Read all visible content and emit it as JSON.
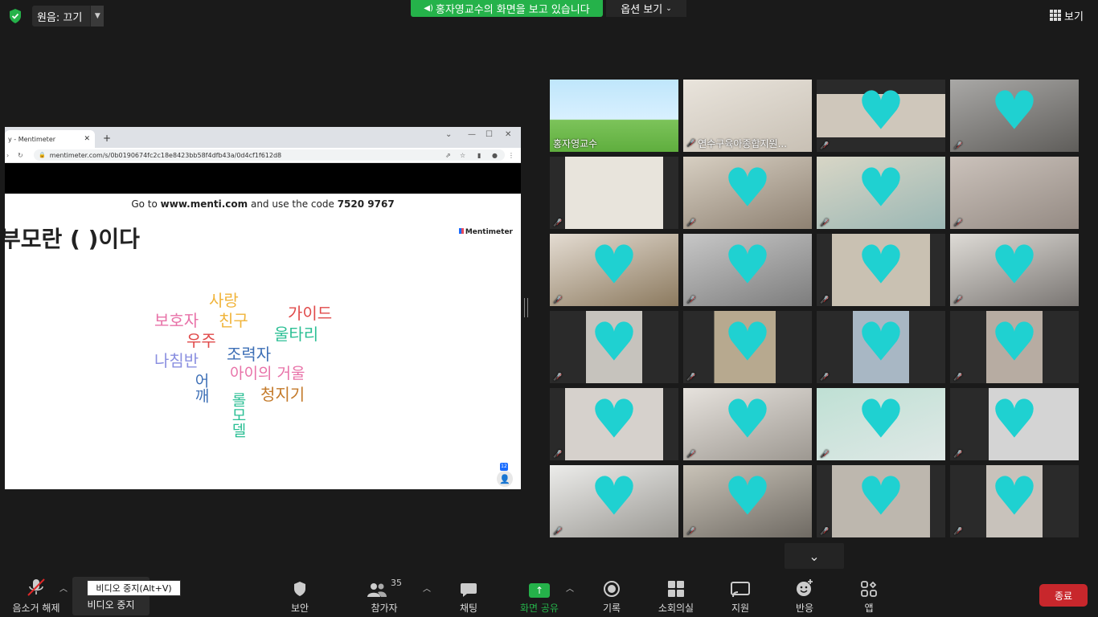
{
  "topbar": {
    "original_sound": "원음: 끄기",
    "share_banner": "홍자영교수의 화면을 보고 있습니다",
    "view_options": "옵션 보기",
    "view_label": "보기"
  },
  "shared_screen": {
    "browser_tab": "y - Mentimeter",
    "url": "mentimeter.com/s/0b0190674fc2c18e8423bb58f4dfb43a/0d4cf1f612d8",
    "code_prefix": "Go to ",
    "code_site": "www.menti.com",
    "code_mid": " and use the code ",
    "code_value": "7520 9767",
    "title": "부모란 ( )이다",
    "logo": "Mentimeter",
    "participant_count": "12",
    "words": [
      {
        "text": "사랑",
        "color": "#f0b43a"
      },
      {
        "text": "가이드",
        "color": "#e04a4a"
      },
      {
        "text": "보호자",
        "color": "#e872a8"
      },
      {
        "text": "친구",
        "color": "#f0b43a"
      },
      {
        "text": "울타리",
        "color": "#2bbf94"
      },
      {
        "text": "우주",
        "color": "#e04a4a"
      },
      {
        "text": "조력자",
        "color": "#3d6fb6"
      },
      {
        "text": "나침반",
        "color": "#8a8fe0"
      },
      {
        "text": "아이의 거울",
        "color": "#e872a8"
      },
      {
        "text": "청지기",
        "color": "#c47a2a"
      },
      {
        "text": "어깨",
        "color": "#3d6fb6"
      },
      {
        "text": "롤모델",
        "color": "#2bbf94"
      }
    ]
  },
  "gallery": {
    "participants": [
      {
        "name": "홍자영교수",
        "muted": false,
        "heart": false
      },
      {
        "name": "연수구육아종합지원...",
        "muted": true,
        "heart": false
      },
      {
        "name": "",
        "muted": true,
        "heart": true
      },
      {
        "name": "",
        "muted": true,
        "heart": true
      },
      {
        "name": "",
        "muted": true,
        "heart": false
      },
      {
        "name": "",
        "muted": true,
        "heart": true
      },
      {
        "name": "",
        "muted": true,
        "heart": true
      },
      {
        "name": "",
        "muted": true,
        "heart": false
      },
      {
        "name": "",
        "muted": true,
        "heart": true
      },
      {
        "name": "",
        "muted": true,
        "heart": true
      },
      {
        "name": "",
        "muted": true,
        "heart": true
      },
      {
        "name": "",
        "muted": true,
        "heart": true
      },
      {
        "name": "",
        "muted": true,
        "heart": true
      },
      {
        "name": "",
        "muted": true,
        "heart": true
      },
      {
        "name": "",
        "muted": true,
        "heart": true
      },
      {
        "name": "",
        "muted": true,
        "heart": true
      },
      {
        "name": "",
        "muted": true,
        "heart": true
      },
      {
        "name": "",
        "muted": true,
        "heart": true
      },
      {
        "name": "",
        "muted": true,
        "heart": true
      },
      {
        "name": "",
        "muted": true,
        "heart": true
      },
      {
        "name": "",
        "muted": true,
        "heart": true
      },
      {
        "name": "",
        "muted": true,
        "heart": true
      },
      {
        "name": "",
        "muted": true,
        "heart": true
      },
      {
        "name": "",
        "muted": true,
        "heart": true
      }
    ]
  },
  "toolbar": {
    "unmute": "음소거 해제",
    "stop_video": "비디오 중지",
    "tooltip": "비디오 중지(Alt+V)",
    "security": "보안",
    "participants": "참가자",
    "participant_count": "35",
    "chat": "채팅",
    "share_screen": "화면 공유",
    "record": "기록",
    "breakout": "소회의실",
    "support": "지원",
    "reactions": "반응",
    "apps": "앱",
    "end": "종료"
  },
  "colors": {
    "share_green": "#25b24a",
    "end_red": "#c8272c",
    "heart": "#1fd1d1",
    "active_speaker": "#d8e84a"
  }
}
